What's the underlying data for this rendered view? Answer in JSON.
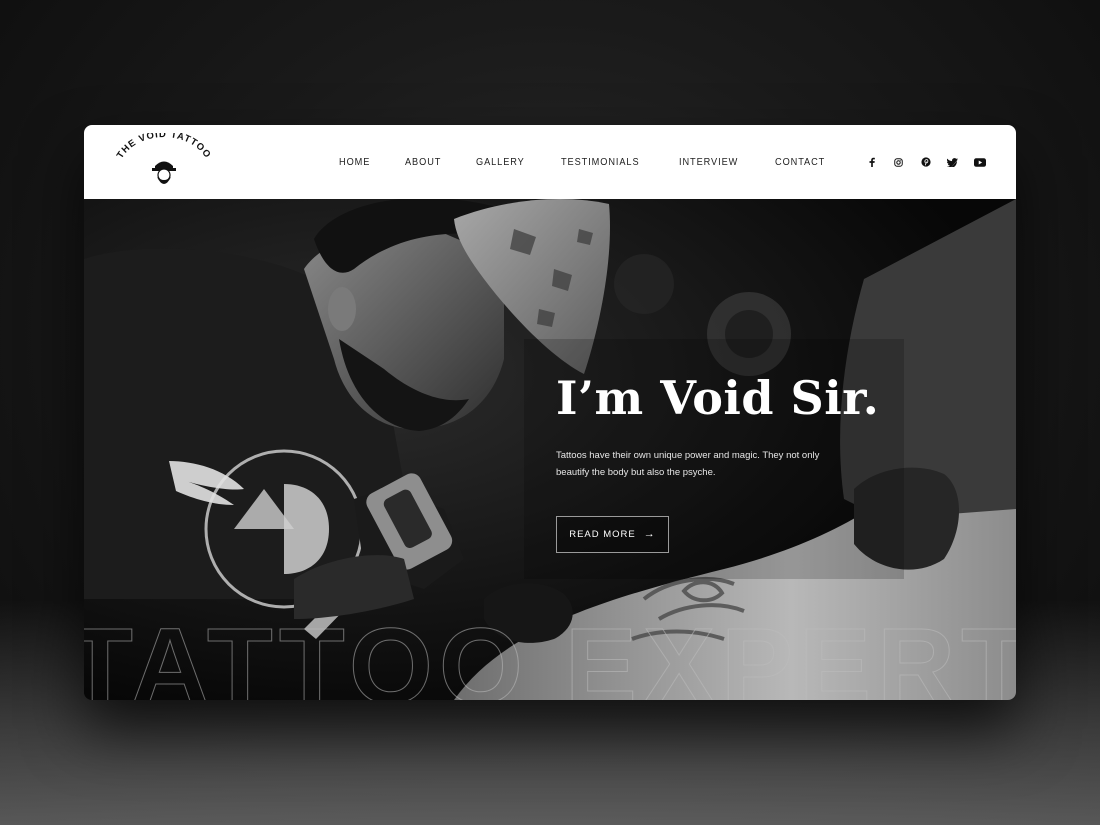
{
  "brand": {
    "logo_text": "THE VOID TATTOO"
  },
  "nav": {
    "items": [
      {
        "label": "HOME"
      },
      {
        "label": "ABOUT"
      },
      {
        "label": "GALLERY"
      },
      {
        "label": "TESTIMONIALS"
      },
      {
        "label": "INTERVIEW"
      },
      {
        "label": "CONTACT"
      }
    ]
  },
  "social": [
    "facebook-icon",
    "instagram-icon",
    "pinterest-icon",
    "twitter-icon",
    "youtube-icon"
  ],
  "hero": {
    "title": "I’m Void Sir.",
    "description": "Tattoos have their own unique power and magic. They not only beautify the body but also the psyche.",
    "cta_label": "READ MORE",
    "cta_icon": "arrow-right-icon",
    "background_word": "TATTOO EXPERT"
  },
  "colors": {
    "navbar_bg": "#ffffff",
    "hero_bg": "#0a0a0a",
    "text_light": "#ffffff"
  }
}
